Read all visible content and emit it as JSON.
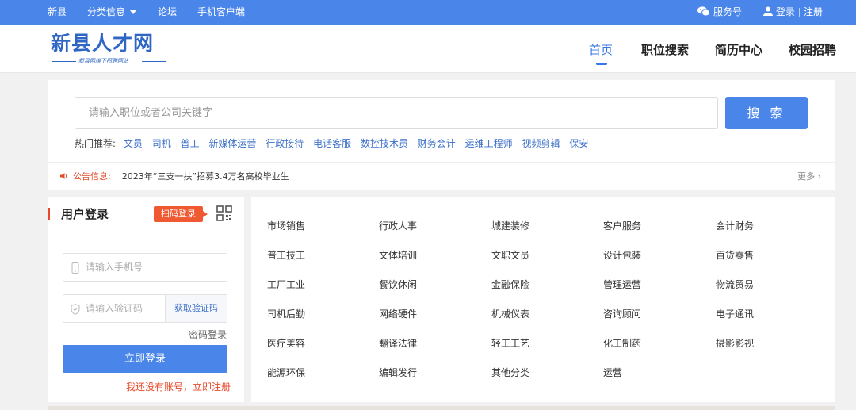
{
  "topbar": {
    "left_links": [
      "新县",
      "分类信息",
      "论坛",
      "手机客户端"
    ],
    "service": "服务号",
    "login": "登录",
    "register": "注册"
  },
  "header": {
    "logo_title": "新县人才网",
    "logo_subtitle": "新县网旗下招聘网站",
    "nav": [
      "首页",
      "职位搜索",
      "简历中心",
      "校园招聘"
    ],
    "active_nav": "首页"
  },
  "search": {
    "placeholder": "请输入职位或者公司关键字",
    "button": "搜 索",
    "hot_label": "热门推荐:",
    "hot_keywords": [
      "文员",
      "司机",
      "普工",
      "新媒体运营",
      "行政接待",
      "电话客服",
      "数控技术员",
      "财务会计",
      "运维工程师",
      "视频剪辑",
      "保安"
    ]
  },
  "notice": {
    "label": "公告信息:",
    "text": "2023年“三支一扶”招募3.4万名高校毕业生",
    "more": "更多 ›"
  },
  "login": {
    "title": "用户登录",
    "scan_label": "扫码登录",
    "phone_placeholder": "请输入手机号",
    "code_placeholder": "请输入验证码",
    "get_code": "获取验证码",
    "password_login": "密码登录",
    "submit": "立即登录",
    "register_prompt": "我还没有账号，立即注册"
  },
  "categories": [
    [
      "市场销售",
      "行政人事",
      "城建装修",
      "客户服务",
      "会计财务"
    ],
    [
      "普工技工",
      "文体培训",
      "文职文员",
      "设计包装",
      "百货零售"
    ],
    [
      "工厂工业",
      "餐饮休闲",
      "金融保险",
      "管理运营",
      "物流贸易"
    ],
    [
      "司机后勤",
      "网络硬件",
      "机械仪表",
      "咨询顾问",
      "电子通讯"
    ],
    [
      "医疗美容",
      "翻译法律",
      "轻工工艺",
      "化工制药",
      "摄影影视"
    ],
    [
      "能源环保",
      "编辑发行",
      "其他分类",
      "运营"
    ]
  ],
  "colors": {
    "primary": "#4a85e9",
    "accent": "#f05a33",
    "link": "#3d70c9"
  }
}
